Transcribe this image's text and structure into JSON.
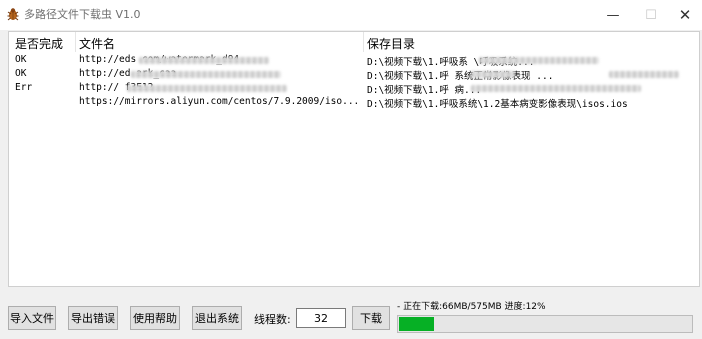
{
  "window": {
    "title": "多路径文件下载虫 V1.0",
    "min_glyph": "—",
    "max_glyph": "☐",
    "close_glyph": "✕"
  },
  "list": {
    "headers": {
      "status": "是否完成",
      "filename": "文件名",
      "save_dir": "保存目录"
    },
    "rows": [
      {
        "status": "OK",
        "filename": "http://eds          com/watermark_d94...",
        "save_dir": "D:\\视频下载\\1.呼吸系        \\呼吸系统..."
      },
      {
        "status": "OK",
        "filename": "http://ed                    ark_caa...",
        "save_dir": "D:\\视频下载\\1.呼         系统正常影像表现          ..."
      },
      {
        "status": "Err",
        "filename": "http://                   f3E12...",
        "save_dir": "D:\\视频下载\\1.呼                     病..."
      },
      {
        "status": "",
        "filename": "https://mirrors.aliyun.com/centos/7.9.2009/iso...",
        "save_dir": "D:\\视频下载\\1.呼吸系统\\1.2基本病变影像表现\\isos.ios"
      }
    ]
  },
  "buttons": {
    "import": "导入文件",
    "export": "导出错误",
    "help": "使用帮助",
    "exit": "退出系统",
    "download": "下载"
  },
  "threads": {
    "label": "线程数:",
    "value": "32"
  },
  "status_text": "- 正在下载:66MB/575MB  进度:12%",
  "progress": {
    "fraction": 0.12
  },
  "colors": {
    "progress_fill": "#06b025",
    "window_bg": "#f0f0f0"
  }
}
